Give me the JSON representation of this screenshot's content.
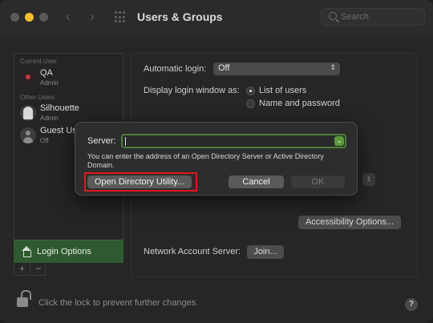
{
  "window": {
    "title": "Users & Groups",
    "search_placeholder": "Search"
  },
  "sidebar": {
    "current_user_header": "Current User",
    "other_users_header": "Other Users",
    "users": [
      {
        "name": "QA",
        "role": "Admin"
      },
      {
        "name": "Silhouette",
        "role": "Admin"
      },
      {
        "name": "Guest User",
        "role": "Off"
      }
    ],
    "login_options_label": "Login Options",
    "add_label": "+",
    "remove_label": "−"
  },
  "main": {
    "automatic_login_label": "Automatic login:",
    "automatic_login_value": "Off",
    "display_login_label": "Display login window as:",
    "display_options": [
      "List of users",
      "Name and password"
    ],
    "display_selected": "List of users",
    "accessibility_button": "Accessibility Options...",
    "network_account_label": "Network Account Server:",
    "join_button": "Join..."
  },
  "footer": {
    "lock_text": "Click the lock to prevent further changes.",
    "help_label": "?"
  },
  "dialog": {
    "server_label": "Server:",
    "server_value": "",
    "hint_text": "You can enter the address of an Open Directory Server or Active Directory Domain.",
    "open_directory_button": "Open Directory Utility...",
    "cancel_button": "Cancel",
    "ok_button": "OK",
    "highlight_color": "#e0181e",
    "focus_color": "#5a9a3a"
  },
  "colors": {
    "accent_selected": "#2f5a2f",
    "minimize_light": "#f3bf2f"
  }
}
